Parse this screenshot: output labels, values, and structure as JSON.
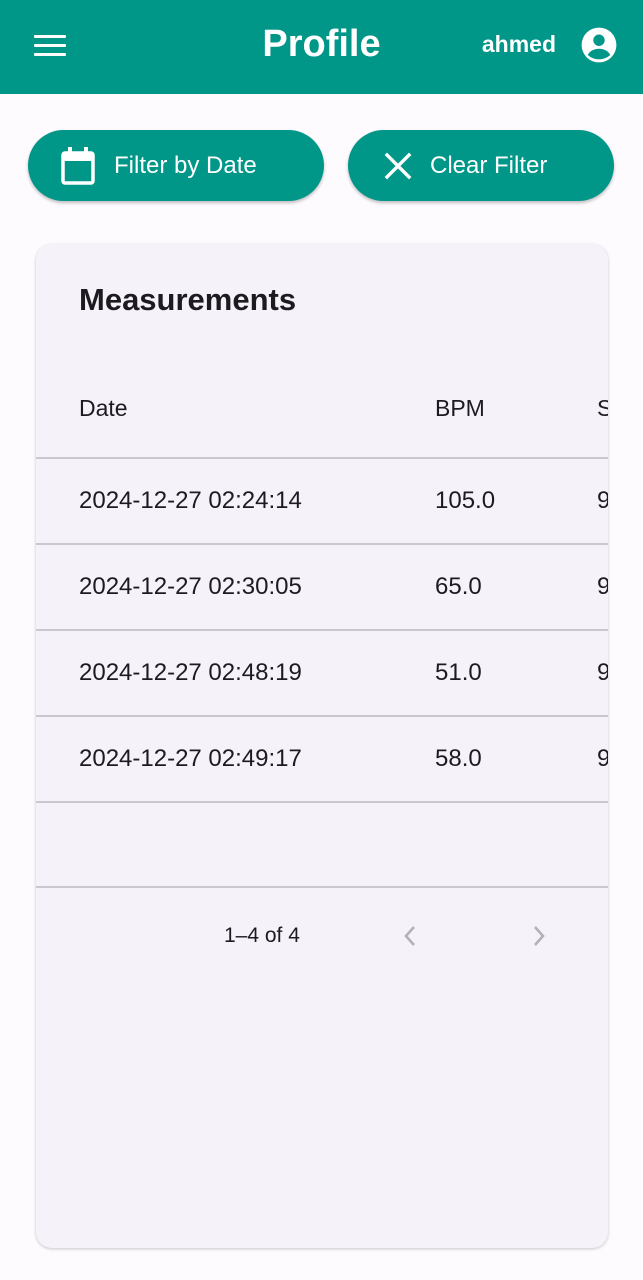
{
  "app_bar": {
    "title": "Profile",
    "username": "ahmed",
    "menu_icon": "menu-icon",
    "account_icon": "account-circle-icon"
  },
  "actions": {
    "filter_label": "Filter by Date",
    "filter_icon": "calendar-icon",
    "clear_label": "Clear Filter",
    "clear_icon": "close-icon"
  },
  "table": {
    "title": "Measurements",
    "columns": [
      "Date",
      "BPM",
      "S"
    ],
    "rows": [
      {
        "date": "2024-12-27 02:24:14",
        "bpm": "105.0",
        "third": "9"
      },
      {
        "date": "2024-12-27 02:30:05",
        "bpm": "65.0",
        "third": "9"
      },
      {
        "date": "2024-12-27 02:48:19",
        "bpm": "51.0",
        "third": "9"
      },
      {
        "date": "2024-12-27 02:49:17",
        "bpm": "58.0",
        "third": "9"
      }
    ],
    "pagination": {
      "range_text": "1–4 of 4",
      "prev_icon": "chevron-left-icon",
      "next_icon": "chevron-right-icon"
    }
  },
  "colors": {
    "primary": "#009688",
    "background": "#fefbff",
    "card": "#f5f2f9",
    "divider": "#cac7cf",
    "text": "#1d1b20",
    "disabled": "#b3b0b8"
  }
}
